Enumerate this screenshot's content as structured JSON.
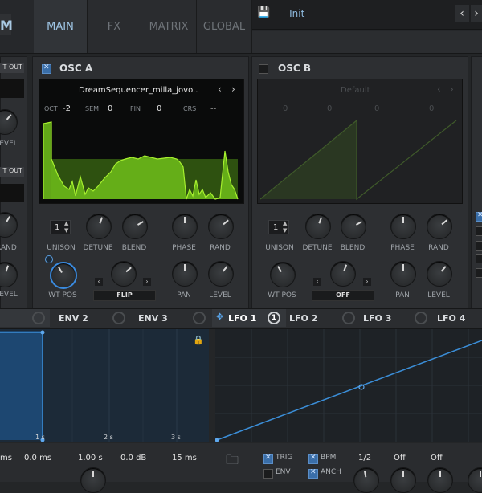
{
  "top_tabs": [
    {
      "label": "MAIN"
    },
    {
      "label": "FX"
    },
    {
      "label": "MATRIX"
    },
    {
      "label": "GLOBAL"
    }
  ],
  "preset": {
    "name": "- Init -"
  },
  "left_strip": {
    "out_label_1": "T OUT",
    "out_label_2": "T OUT",
    "level": "LEVEL",
    "rand": "RAND"
  },
  "osc_a": {
    "title": "OSC A",
    "wavetable": "DreamSequencer_milla_jovo..",
    "oct_label": "OCT",
    "oct_val": "-2",
    "sem_label": "SEM",
    "sem_val": "0",
    "fin_label": "FIN",
    "fin_val": "0",
    "crs_label": "CRS",
    "crs_val": "--",
    "unison": "1",
    "labels": {
      "unison": "UNISON",
      "detune": "DETUNE",
      "blend": "BLEND",
      "phase": "PHASE",
      "rand": "RAND",
      "wtpos": "WT POS",
      "pan": "PAN",
      "level": "LEVEL"
    },
    "warp": "FLIP"
  },
  "osc_b": {
    "title": "OSC B",
    "wavetable": "Default",
    "oct_val": "0",
    "sem_val": "0",
    "fin_val": "0",
    "crs_val": "0",
    "unison": "1",
    "labels": {
      "unison": "UNISON",
      "detune": "DETUNE",
      "blend": "BLEND",
      "phase": "PHASE",
      "rand": "RAND",
      "wtpos": "WT POS",
      "pan": "PAN",
      "level": "LEVEL"
    },
    "warp": "OFF"
  },
  "mod_tabs": {
    "env2": "ENV 2",
    "env3": "ENV 3",
    "lfo1": "LFO 1",
    "lfo1_badge": "1",
    "lfo2": "LFO 2",
    "lfo3": "LFO 3",
    "lfo4": "LFO 4"
  },
  "env_graph": {
    "t1": "1 s",
    "t2": "2 s",
    "t3": "3 s"
  },
  "env_values": {
    "v0": "ms",
    "v1": "0.0 ms",
    "v2": "1.00 s",
    "v3": "0.0 dB",
    "v4": "15 ms"
  },
  "lfo_controls": {
    "trig": "TRIG",
    "env": "ENV",
    "bpm": "BPM",
    "anch": "ANCH",
    "rate": "1/2",
    "off1": "Off",
    "off2": "Off"
  },
  "colors": {
    "accent": "#9fc6e6",
    "wave": "#7cd11d",
    "lfo_line": "#3b8ed8"
  }
}
